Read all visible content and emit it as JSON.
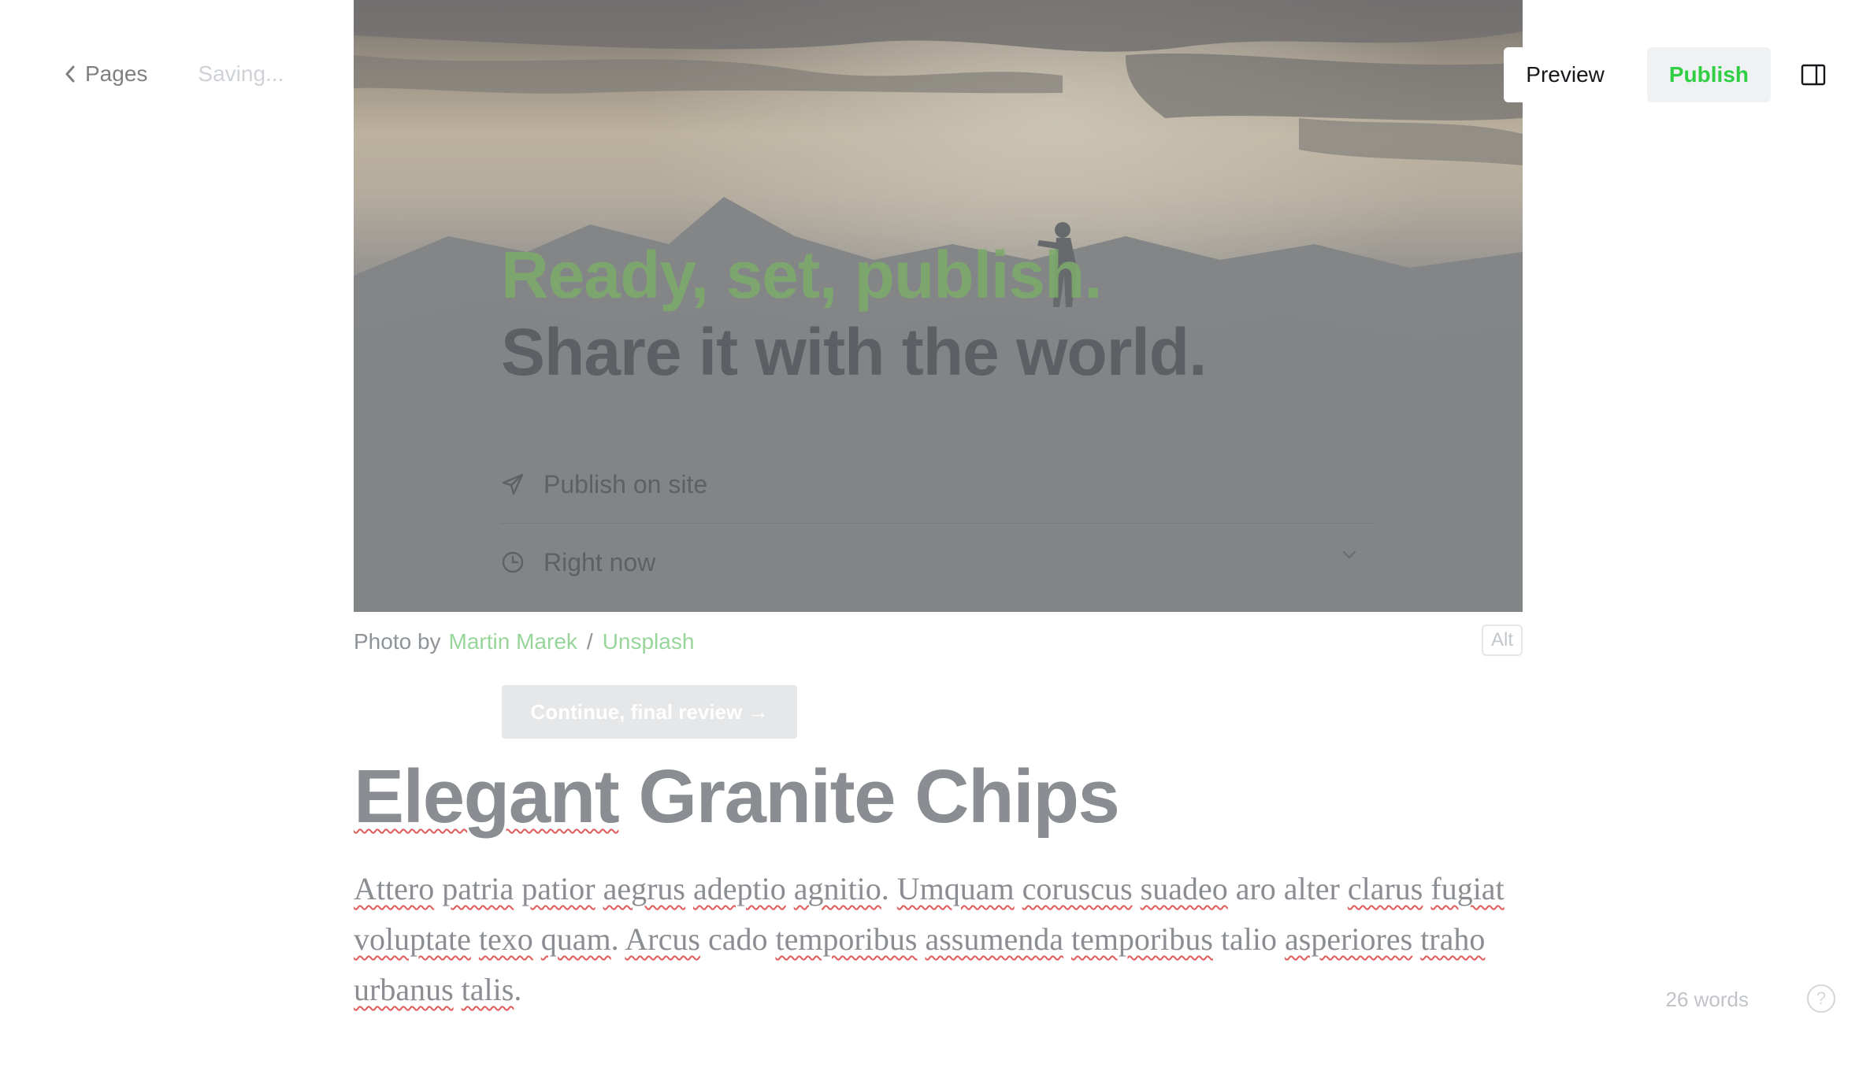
{
  "header": {
    "back_label": "Pages",
    "saving_status": "Saving...",
    "preview_label": "Preview",
    "publish_label": "Publish"
  },
  "publish_flow": {
    "title_line1": "Ready, set, publish.",
    "title_line2": "Share it with the world.",
    "publish_target": "Publish on site",
    "schedule_option": "Right now",
    "continue_label": "Continue, final review →"
  },
  "feature_image": {
    "caption_prefix": "Photo by",
    "photographer": "Martin Marek",
    "separator": "/",
    "source": "Unsplash",
    "alt_label": "Alt"
  },
  "post": {
    "title_words": [
      "Elegant",
      "Granite Chips"
    ],
    "body_segments": [
      {
        "t": "Attero",
        "s": true
      },
      {
        "t": " "
      },
      {
        "t": "patria",
        "s": true
      },
      {
        "t": " "
      },
      {
        "t": "patior",
        "s": true
      },
      {
        "t": " "
      },
      {
        "t": "aegrus",
        "s": true
      },
      {
        "t": " "
      },
      {
        "t": "adeptio",
        "s": true
      },
      {
        "t": " "
      },
      {
        "t": "agnitio",
        "s": true
      },
      {
        "t": ". "
      },
      {
        "t": "Umquam",
        "s": true
      },
      {
        "t": " "
      },
      {
        "t": "coruscus",
        "s": true
      },
      {
        "t": " "
      },
      {
        "t": "suadeo",
        "s": true
      },
      {
        "t": " aro alter "
      },
      {
        "t": "clarus",
        "s": true
      },
      {
        "t": " "
      },
      {
        "t": "fugiat",
        "s": true
      },
      {
        "t": " "
      },
      {
        "t": "voluptate",
        "s": true
      },
      {
        "t": " "
      },
      {
        "t": "texo",
        "s": true
      },
      {
        "t": " "
      },
      {
        "t": "quam",
        "s": true
      },
      {
        "t": ". "
      },
      {
        "t": "Arcus",
        "s": true
      },
      {
        "t": " cado "
      },
      {
        "t": "temporibus",
        "s": true
      },
      {
        "t": " "
      },
      {
        "t": "assumenda",
        "s": true
      },
      {
        "t": " "
      },
      {
        "t": "temporibus",
        "s": true
      },
      {
        "t": " talio "
      },
      {
        "t": "asperiores",
        "s": true
      },
      {
        "t": " "
      },
      {
        "t": "traho",
        "s": true
      },
      {
        "t": " "
      },
      {
        "t": "urbanus",
        "s": true
      },
      {
        "t": " "
      },
      {
        "t": "talis",
        "s": true
      },
      {
        "t": "."
      }
    ]
  },
  "footer": {
    "word_count": "26 words",
    "help_symbol": "?"
  },
  "icons": {
    "back": "chevron-left-icon",
    "sidebar": "sidebar-toggle-icon",
    "publish_target": "paper-plane-icon",
    "schedule": "clock-icon",
    "dropdown": "chevron-down-icon",
    "help": "question-icon"
  },
  "colors": {
    "accent_green": "#30cf43",
    "link_green": "#98d59a",
    "spellcheck_red": "#e05b58"
  }
}
